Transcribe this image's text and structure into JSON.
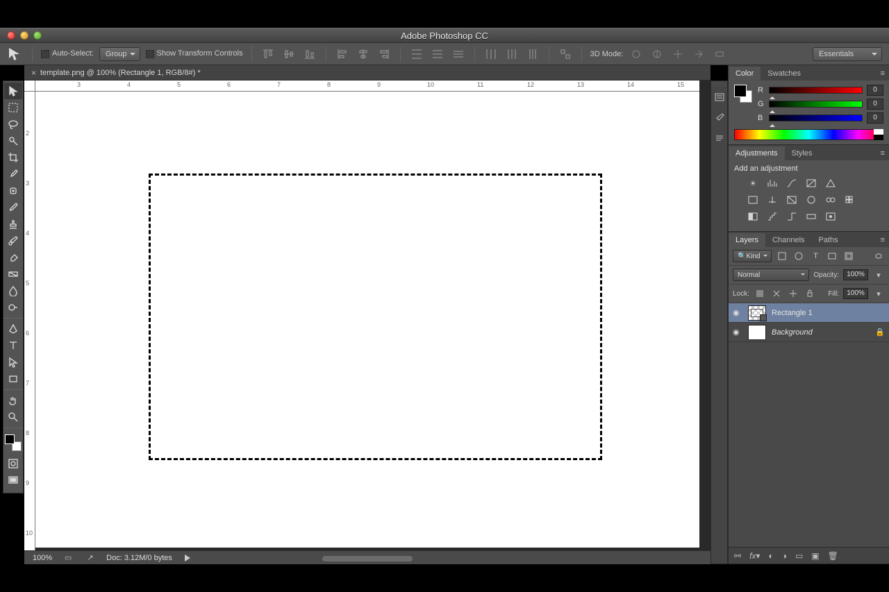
{
  "titlebar": {
    "title": "Adobe Photoshop CC"
  },
  "tab": {
    "name": "template.png @ 100% (Rectangle 1, RGB/8#) *"
  },
  "options": {
    "auto_select_label": "Auto-Select:",
    "auto_select_target": "Group",
    "show_transform_label": "Show Transform Controls",
    "mode3d_label": "3D Mode:",
    "workspace": "Essentials"
  },
  "ruler": {
    "hticks": [
      "3",
      "4",
      "5",
      "6",
      "7",
      "8",
      "9",
      "10",
      "11",
      "12",
      "13",
      "14",
      "15"
    ],
    "vticks": [
      "2",
      "3",
      "4",
      "5",
      "6",
      "7",
      "8",
      "9",
      "10"
    ]
  },
  "color_panel": {
    "tab_color": "Color",
    "tab_swatches": "Swatches",
    "r_label": "R",
    "g_label": "G",
    "b_label": "B",
    "r_val": "0",
    "g_val": "0",
    "b_val": "0"
  },
  "adjustments_panel": {
    "tab_adjustments": "Adjustments",
    "tab_styles": "Styles",
    "heading": "Add an adjustment"
  },
  "layers_panel": {
    "tab_layers": "Layers",
    "tab_channels": "Channels",
    "tab_paths": "Paths",
    "filter_label": "Kind",
    "blend_mode": "Normal",
    "opacity_label": "Opacity:",
    "opacity_val": "100%",
    "lock_label": "Lock:",
    "fill_label": "Fill:",
    "fill_val": "100%",
    "layers": [
      {
        "name": "Rectangle 1",
        "selected": true,
        "checker": true
      },
      {
        "name": "Background",
        "selected": false,
        "checker": false,
        "locked": true
      }
    ]
  },
  "status": {
    "zoom": "100%",
    "doc": "Doc: 3.12M/0 bytes"
  }
}
